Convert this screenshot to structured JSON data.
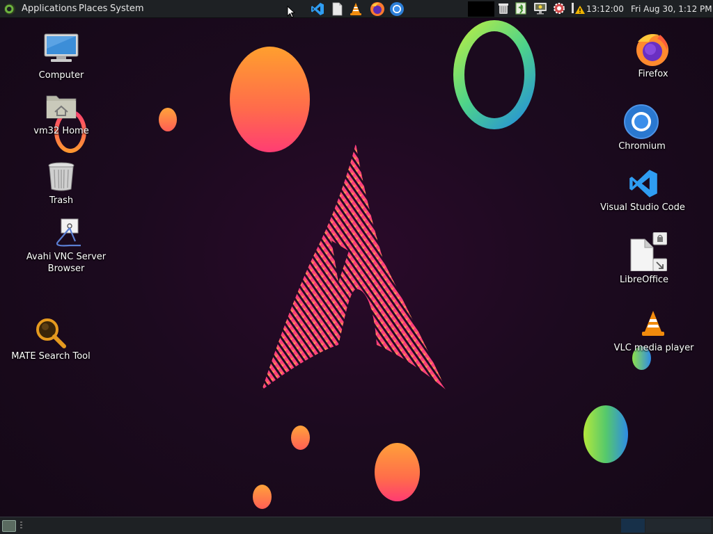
{
  "top_panel": {
    "menus": [
      "Applications",
      "Places",
      "System"
    ],
    "launchers": [
      "vscode-icon",
      "text-editor-icon",
      "vlc-icon",
      "firefox-icon",
      "chromium-icon"
    ],
    "tray_icons": [
      "trash-icon",
      "exit-icon",
      "screen-icon",
      "settings-gear-icon",
      "network-warning-icon"
    ],
    "clock": "13:12:00",
    "date": "Fri Aug 30,  1:12 PM"
  },
  "desktop_left": [
    {
      "label": "Computer",
      "icon": "computer-icon"
    },
    {
      "label": "vm32 Home",
      "icon": "home-folder-icon"
    },
    {
      "label": "Trash",
      "icon": "trash-icon"
    },
    {
      "label": "Avahi VNC Server\nBrowser",
      "icon": "avahi-vnc-icon"
    },
    {
      "label": "MATE Search Tool",
      "icon": "search-tool-icon"
    }
  ],
  "desktop_right": [
    {
      "label": "Firefox",
      "icon": "firefox-icon"
    },
    {
      "label": "Chromium",
      "icon": "chromium-icon"
    },
    {
      "label": "Visual Studio Code",
      "icon": "vscode-icon"
    },
    {
      "label": "LibreOffice",
      "icon": "libreoffice-icon"
    },
    {
      "label": "VLC media player",
      "icon": "vlc-icon"
    }
  ],
  "colors": {
    "panel": "#1e2124",
    "desktop_bg": "#1c0a1f",
    "orb_orange": "#ff8c3a",
    "orb_pink": "#ff3d73",
    "orb_green": "#a4e84a",
    "orb_blue": "#2e8be6"
  }
}
